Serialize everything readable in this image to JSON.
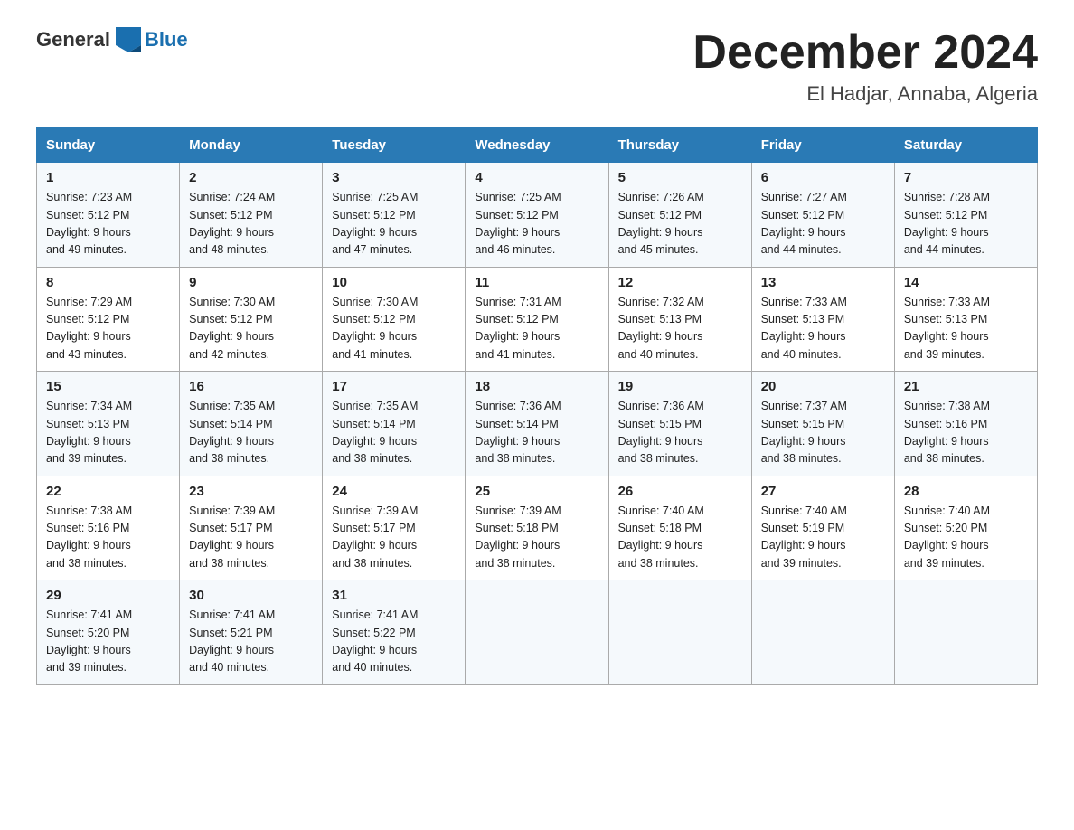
{
  "header": {
    "logo_general": "General",
    "logo_blue": "Blue",
    "month_title": "December 2024",
    "location": "El Hadjar, Annaba, Algeria"
  },
  "days_of_week": [
    "Sunday",
    "Monday",
    "Tuesday",
    "Wednesday",
    "Thursday",
    "Friday",
    "Saturday"
  ],
  "weeks": [
    [
      {
        "day": "1",
        "info": "Sunrise: 7:23 AM\nSunset: 5:12 PM\nDaylight: 9 hours\nand 49 minutes."
      },
      {
        "day": "2",
        "info": "Sunrise: 7:24 AM\nSunset: 5:12 PM\nDaylight: 9 hours\nand 48 minutes."
      },
      {
        "day": "3",
        "info": "Sunrise: 7:25 AM\nSunset: 5:12 PM\nDaylight: 9 hours\nand 47 minutes."
      },
      {
        "day": "4",
        "info": "Sunrise: 7:25 AM\nSunset: 5:12 PM\nDaylight: 9 hours\nand 46 minutes."
      },
      {
        "day": "5",
        "info": "Sunrise: 7:26 AM\nSunset: 5:12 PM\nDaylight: 9 hours\nand 45 minutes."
      },
      {
        "day": "6",
        "info": "Sunrise: 7:27 AM\nSunset: 5:12 PM\nDaylight: 9 hours\nand 44 minutes."
      },
      {
        "day": "7",
        "info": "Sunrise: 7:28 AM\nSunset: 5:12 PM\nDaylight: 9 hours\nand 44 minutes."
      }
    ],
    [
      {
        "day": "8",
        "info": "Sunrise: 7:29 AM\nSunset: 5:12 PM\nDaylight: 9 hours\nand 43 minutes."
      },
      {
        "day": "9",
        "info": "Sunrise: 7:30 AM\nSunset: 5:12 PM\nDaylight: 9 hours\nand 42 minutes."
      },
      {
        "day": "10",
        "info": "Sunrise: 7:30 AM\nSunset: 5:12 PM\nDaylight: 9 hours\nand 41 minutes."
      },
      {
        "day": "11",
        "info": "Sunrise: 7:31 AM\nSunset: 5:12 PM\nDaylight: 9 hours\nand 41 minutes."
      },
      {
        "day": "12",
        "info": "Sunrise: 7:32 AM\nSunset: 5:13 PM\nDaylight: 9 hours\nand 40 minutes."
      },
      {
        "day": "13",
        "info": "Sunrise: 7:33 AM\nSunset: 5:13 PM\nDaylight: 9 hours\nand 40 minutes."
      },
      {
        "day": "14",
        "info": "Sunrise: 7:33 AM\nSunset: 5:13 PM\nDaylight: 9 hours\nand 39 minutes."
      }
    ],
    [
      {
        "day": "15",
        "info": "Sunrise: 7:34 AM\nSunset: 5:13 PM\nDaylight: 9 hours\nand 39 minutes."
      },
      {
        "day": "16",
        "info": "Sunrise: 7:35 AM\nSunset: 5:14 PM\nDaylight: 9 hours\nand 38 minutes."
      },
      {
        "day": "17",
        "info": "Sunrise: 7:35 AM\nSunset: 5:14 PM\nDaylight: 9 hours\nand 38 minutes."
      },
      {
        "day": "18",
        "info": "Sunrise: 7:36 AM\nSunset: 5:14 PM\nDaylight: 9 hours\nand 38 minutes."
      },
      {
        "day": "19",
        "info": "Sunrise: 7:36 AM\nSunset: 5:15 PM\nDaylight: 9 hours\nand 38 minutes."
      },
      {
        "day": "20",
        "info": "Sunrise: 7:37 AM\nSunset: 5:15 PM\nDaylight: 9 hours\nand 38 minutes."
      },
      {
        "day": "21",
        "info": "Sunrise: 7:38 AM\nSunset: 5:16 PM\nDaylight: 9 hours\nand 38 minutes."
      }
    ],
    [
      {
        "day": "22",
        "info": "Sunrise: 7:38 AM\nSunset: 5:16 PM\nDaylight: 9 hours\nand 38 minutes."
      },
      {
        "day": "23",
        "info": "Sunrise: 7:39 AM\nSunset: 5:17 PM\nDaylight: 9 hours\nand 38 minutes."
      },
      {
        "day": "24",
        "info": "Sunrise: 7:39 AM\nSunset: 5:17 PM\nDaylight: 9 hours\nand 38 minutes."
      },
      {
        "day": "25",
        "info": "Sunrise: 7:39 AM\nSunset: 5:18 PM\nDaylight: 9 hours\nand 38 minutes."
      },
      {
        "day": "26",
        "info": "Sunrise: 7:40 AM\nSunset: 5:18 PM\nDaylight: 9 hours\nand 38 minutes."
      },
      {
        "day": "27",
        "info": "Sunrise: 7:40 AM\nSunset: 5:19 PM\nDaylight: 9 hours\nand 39 minutes."
      },
      {
        "day": "28",
        "info": "Sunrise: 7:40 AM\nSunset: 5:20 PM\nDaylight: 9 hours\nand 39 minutes."
      }
    ],
    [
      {
        "day": "29",
        "info": "Sunrise: 7:41 AM\nSunset: 5:20 PM\nDaylight: 9 hours\nand 39 minutes."
      },
      {
        "day": "30",
        "info": "Sunrise: 7:41 AM\nSunset: 5:21 PM\nDaylight: 9 hours\nand 40 minutes."
      },
      {
        "day": "31",
        "info": "Sunrise: 7:41 AM\nSunset: 5:22 PM\nDaylight: 9 hours\nand 40 minutes."
      },
      {
        "day": "",
        "info": ""
      },
      {
        "day": "",
        "info": ""
      },
      {
        "day": "",
        "info": ""
      },
      {
        "day": "",
        "info": ""
      }
    ]
  ]
}
